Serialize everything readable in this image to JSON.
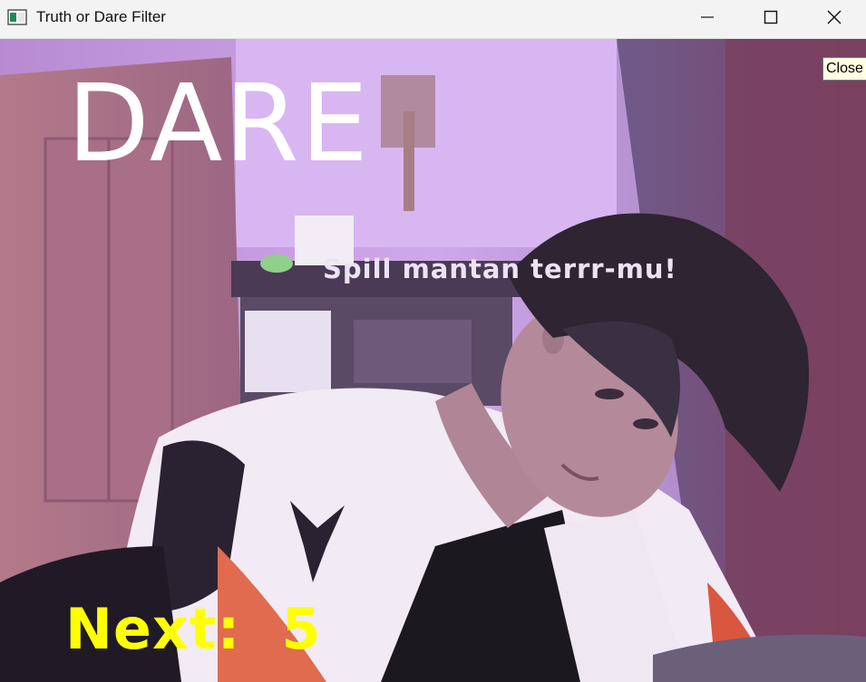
{
  "window": {
    "title": "Truth or Dare Filter",
    "minimize_icon": "minimize-icon",
    "maximize_icon": "maximize-icon",
    "close_icon": "close-icon",
    "close_tooltip": "Close"
  },
  "overlay": {
    "mode_label": "DARE",
    "prompt_text": "Spill mantan terrr-mu!",
    "next_label": "Next:",
    "next_count": "5",
    "mode_color": "#ffffff",
    "prompt_color": "#ebe3f3",
    "next_color": "#ffff00"
  },
  "feed": {
    "description_tint": "#c79be6"
  }
}
